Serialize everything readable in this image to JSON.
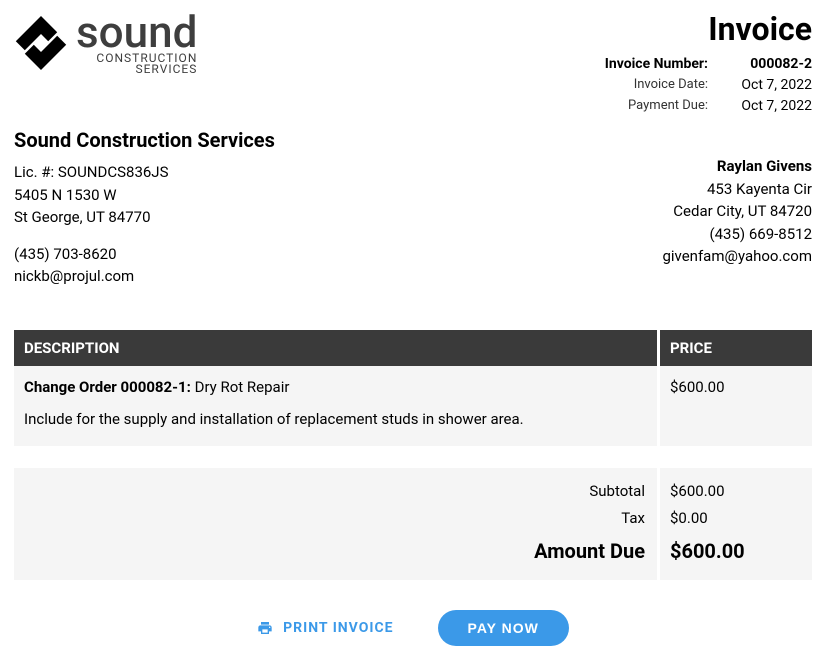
{
  "logo": {
    "word": "sound",
    "sub1": "CONSTRUCTION",
    "sub2": "SERVICES"
  },
  "invoice": {
    "title": "Invoice",
    "number_label": "Invoice Number:",
    "number": "000082-2",
    "date_label": "Invoice Date:",
    "date": "Oct 7, 2022",
    "due_label": "Payment Due:",
    "due": "Oct 7, 2022"
  },
  "from": {
    "company": "Sound Construction Services",
    "license": "Lic. #: SOUNDCS836JS",
    "street": "5405 N 1530 W",
    "city": "St George, UT 84770",
    "phone": "(435) 703-8620",
    "email": "nickb@projul.com"
  },
  "to": {
    "name": "Raylan Givens",
    "street": "453 Kayenta Cir",
    "city": "Cedar City, UT 84720",
    "phone": "(435) 669-8512",
    "email": "givenfam@yahoo.com"
  },
  "table": {
    "headers": {
      "description": "DESCRIPTION",
      "price": "PRICE"
    },
    "rows": [
      {
        "title_bold": "Change Order 000082-1:",
        "title_rest": " Dry Rot Repair",
        "detail": "Include for the supply and installation of replacement studs in shower area.",
        "price": "$600.00"
      }
    ]
  },
  "totals": {
    "subtotal_label": "Subtotal",
    "subtotal": "$600.00",
    "tax_label": "Tax",
    "tax": "$0.00",
    "due_label": "Amount Due",
    "due": "$600.00"
  },
  "actions": {
    "print": "PRINT INVOICE",
    "pay": "PAY NOW"
  }
}
